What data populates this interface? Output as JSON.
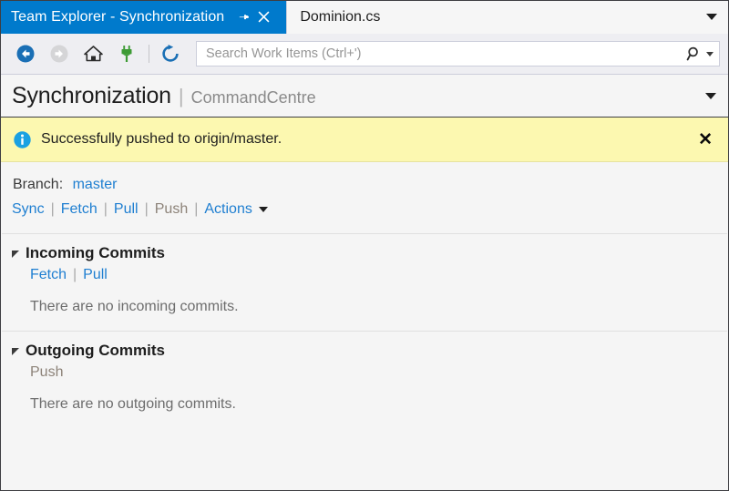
{
  "titlebar": {
    "tool_window_title": "Team Explorer - Synchronization",
    "pin_icon": "pin-icon",
    "close_icon": "close-icon",
    "document_tab": "Dominion.cs",
    "document_tab_caret": "chevron-down-icon"
  },
  "toolbar": {
    "back_label": "back-arrow-icon",
    "forward_label": "forward-arrow-icon",
    "home_label": "home-icon",
    "connect_label": "plug-connect-icon",
    "refresh_label": "refresh-icon",
    "search_icon": "search-icon",
    "search_caret": "chevron-down-icon"
  },
  "search": {
    "value": "",
    "placeholder": "Search Work Items (Ctrl+')"
  },
  "header": {
    "title": "Synchronization",
    "separator": "|",
    "subtitle": "CommandCentre",
    "caret": "chevron-down-icon"
  },
  "notification": {
    "icon": "info-icon",
    "message": "Successfully pushed to origin/master.",
    "close_label": "✕",
    "background_color": "#fcf8b0"
  },
  "branch": {
    "label": "Branch:",
    "name": "master"
  },
  "actions": {
    "items": [
      {
        "label": "Sync",
        "enabled": true
      },
      {
        "label": "Fetch",
        "enabled": true
      },
      {
        "label": "Pull",
        "enabled": true
      },
      {
        "label": "Push",
        "enabled": false
      },
      {
        "label": "Actions",
        "enabled": true
      }
    ],
    "separator": "|",
    "caret": "chevron-down-icon"
  },
  "sections": [
    {
      "title": "Incoming Commits",
      "expander": "triangle-collapse-icon",
      "links": [
        {
          "label": "Fetch",
          "enabled": true
        },
        {
          "label": "Pull",
          "enabled": true
        }
      ],
      "separator": "|",
      "message": "There are no incoming commits."
    },
    {
      "title": "Outgoing Commits",
      "expander": "triangle-collapse-icon",
      "links": [
        {
          "label": "Push",
          "enabled": false
        }
      ],
      "separator": "",
      "message": "There are no outgoing commits."
    }
  ],
  "colors": {
    "titlebar": "#007acc",
    "link": "#1f7fd1",
    "disabled_link": "#8d8379",
    "notification_bg": "#fcf8b0",
    "window_bg": "#f5f5f5"
  }
}
